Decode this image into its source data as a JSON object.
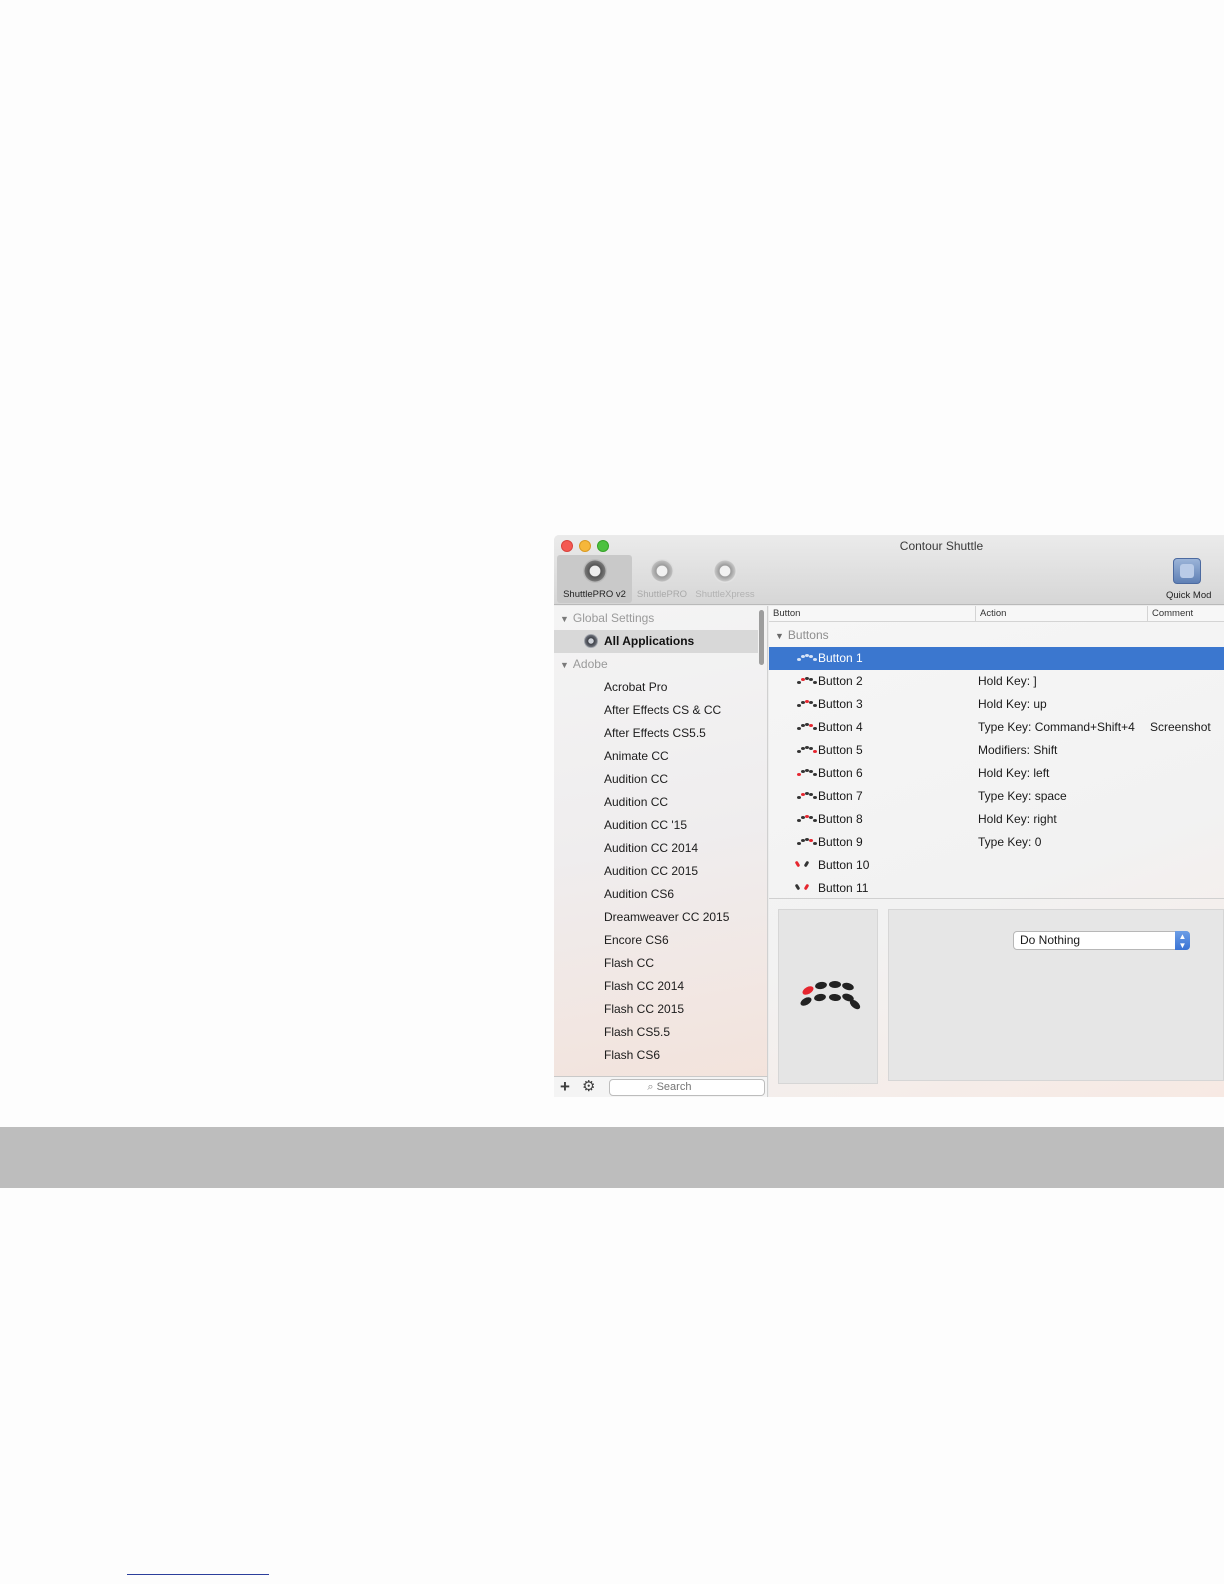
{
  "window": {
    "title": "Contour Shuttle",
    "toolbar": {
      "devices": [
        {
          "label": "ShuttlePRO v2",
          "active": true
        },
        {
          "label": "ShuttlePRO",
          "active": false
        },
        {
          "label": "ShuttleXpress",
          "active": false
        }
      ],
      "quick_mode_label": "Quick Mod"
    }
  },
  "sidebar": {
    "global_group": "Global Settings",
    "all_applications": "All Applications",
    "adobe_group": "Adobe",
    "apps": [
      "Acrobat Pro",
      "After Effects CS & CC",
      "After Effects CS5.5",
      "Animate CC",
      "Audition CC",
      "Audition CC",
      "Audition CC '15",
      "Audition CC 2014",
      "Audition CC 2015",
      "Audition CS6",
      "Dreamweaver CC 2015",
      "Encore CS6",
      "Flash CC",
      "Flash CC 2014",
      "Flash CC 2015",
      "Flash CS5.5",
      "Flash CS6"
    ],
    "search_placeholder": "Search"
  },
  "table": {
    "columns": {
      "button": "Button",
      "action": "Action",
      "comment": "Comment"
    },
    "group": "Buttons",
    "rows": [
      {
        "button": "Button 1",
        "action": "",
        "comment": "",
        "selected": true
      },
      {
        "button": "Button 2",
        "action": "Hold Key: ]",
        "comment": ""
      },
      {
        "button": "Button 3",
        "action": "Hold Key: up",
        "comment": ""
      },
      {
        "button": "Button 4",
        "action": "Type Key: Command+Shift+4",
        "comment": "Screenshot"
      },
      {
        "button": "Button 5",
        "action": "Modifiers: Shift",
        "comment": ""
      },
      {
        "button": "Button 6",
        "action": "Hold Key: left",
        "comment": ""
      },
      {
        "button": "Button 7",
        "action": "Type Key: space",
        "comment": ""
      },
      {
        "button": "Button 8",
        "action": "Hold Key: right",
        "comment": ""
      },
      {
        "button": "Button 9",
        "action": "Type Key: 0",
        "comment": ""
      },
      {
        "button": "Button 10",
        "action": "",
        "comment": ""
      },
      {
        "button": "Button 11",
        "action": "",
        "comment": ""
      }
    ]
  },
  "detail": {
    "action_select_value": "Do Nothing"
  },
  "colors": {
    "selection": "#3b77cf",
    "highlighted_button": "#e6262f",
    "close": "#f45952",
    "minimize": "#f6b73a",
    "maximize": "#4cc13f"
  }
}
